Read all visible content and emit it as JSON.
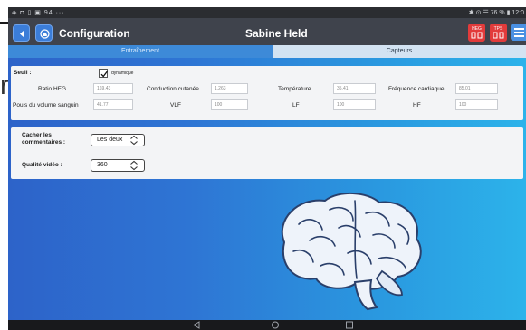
{
  "statusbar": {
    "left": "◈ ◘ ▯ ▣ 94 ···",
    "right": "✱ ⊙ ☰ 76 % ▮ 12:0"
  },
  "toolbar": {
    "title": "Configuration",
    "user": "Sabine Held",
    "heg_label": "HEG",
    "tps_label": "TPS"
  },
  "tabs": [
    {
      "label": "Entraînement",
      "active": true
    },
    {
      "label": "Capteurs",
      "active": false
    }
  ],
  "threshold": {
    "label": "Seuil :",
    "dynamic_label": "dynamique",
    "dynamic_checked": true
  },
  "sensors": {
    "ratio_heg": {
      "label": "Ratio HEG",
      "value": "169.43"
    },
    "skin_conductance": {
      "label": "Conduction cutanée",
      "value": "1.263"
    },
    "temperature": {
      "label": "Température",
      "value": "35.41"
    },
    "heart_rate": {
      "label": "Fréquence cardiaque",
      "value": "85.01"
    },
    "blood_volume_pulse": {
      "label": "Pouls du volume sanguin",
      "value": "41.77"
    },
    "vlf": {
      "label": "VLF",
      "value": "100"
    },
    "lf": {
      "label": "LF",
      "value": "100"
    },
    "hf": {
      "label": "HF",
      "value": "100"
    }
  },
  "comments": {
    "label_line1": "Cacher les",
    "label_line2": "commentaires :",
    "value": "Les deux"
  },
  "video": {
    "label": "Qualité vidéo :",
    "value": "360"
  },
  "colors": {
    "accent": "#3d8ad8",
    "toolbar": "#3f434c",
    "alert_red": "#e23b3b"
  }
}
